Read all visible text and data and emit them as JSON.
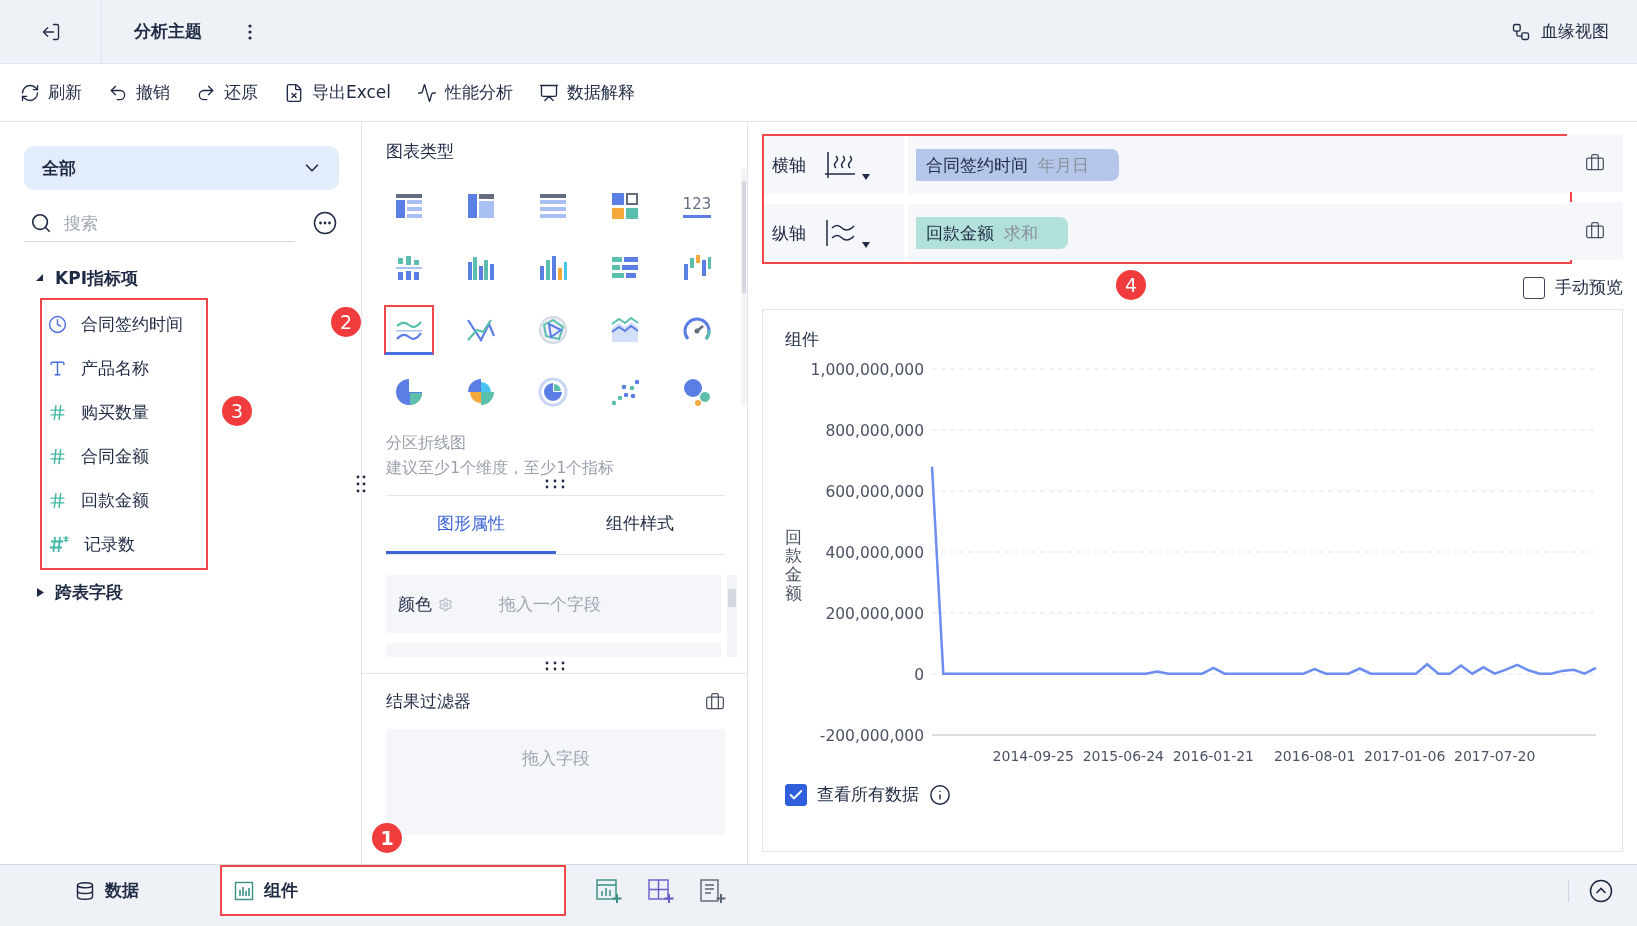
{
  "header": {
    "title": "分析主题",
    "lineage_button": "血缘视图"
  },
  "toolbar": [
    {
      "kind": "refresh",
      "label": "刷新"
    },
    {
      "kind": "undo",
      "label": "撤销"
    },
    {
      "kind": "redo",
      "label": "还原"
    },
    {
      "kind": "export",
      "label": "导出Excel"
    },
    {
      "kind": "performance",
      "label": "性能分析"
    },
    {
      "kind": "explain",
      "label": "数据解释"
    }
  ],
  "data_panel": {
    "scope": "全部",
    "search": {
      "placeholder": "搜索"
    },
    "groups": [
      {
        "label": "KPI指标项",
        "expanded": true,
        "highlighted": true,
        "badge": "3",
        "children": [
          {
            "kind": "date",
            "label": "合同签约时间"
          },
          {
            "kind": "text",
            "label": "产品名称"
          },
          {
            "kind": "number",
            "label": "购买数量"
          },
          {
            "kind": "number",
            "label": "合同金额"
          },
          {
            "kind": "number",
            "label": "回款金额"
          },
          {
            "kind": "count",
            "label": "记录数"
          }
        ]
      },
      {
        "label": "跨表字段",
        "expanded": false
      }
    ]
  },
  "chart_type_panel": {
    "title": "图表类型",
    "badge": "2",
    "types": [
      {
        "kind": "grouped-table",
        "selected": false
      },
      {
        "kind": "cross-table",
        "selected": false
      },
      {
        "kind": "detail-table",
        "selected": false
      },
      {
        "kind": "tile",
        "selected": false
      },
      {
        "kind": "number",
        "glyph": "123",
        "selected": false
      },
      {
        "kind": "stacked-bar",
        "selected": false
      },
      {
        "kind": "grouped-column",
        "selected": false
      },
      {
        "kind": "column",
        "selected": false
      },
      {
        "kind": "bar",
        "selected": false
      },
      {
        "kind": "waterfall",
        "selected": false
      },
      {
        "kind": "partition-line",
        "selected": true
      },
      {
        "kind": "line",
        "selected": false
      },
      {
        "kind": "radar",
        "selected": false
      },
      {
        "kind": "area",
        "selected": false
      },
      {
        "kind": "gauge",
        "selected": false
      },
      {
        "kind": "pie",
        "selected": false
      },
      {
        "kind": "rose",
        "selected": false
      },
      {
        "kind": "ring",
        "selected": false
      },
      {
        "kind": "scatter",
        "selected": false
      },
      {
        "kind": "bubble",
        "selected": false
      }
    ],
    "description": "分区折线图",
    "hint": "建议至少1个维度，至少1个指标",
    "tabs": [
      {
        "label": "图形属性",
        "selected": true
      },
      {
        "label": "组件样式",
        "selected": false
      }
    ],
    "properties": [
      {
        "label": "颜色",
        "drop_hint": "拖入一个字段"
      }
    ],
    "filter": {
      "title": "结果过滤器",
      "drop_hint": "拖入字段"
    }
  },
  "axes": {
    "highlighted": true,
    "badge": "4",
    "rows": [
      {
        "kind": "x",
        "label": "横轴",
        "field": "合同签约时间",
        "aggregation": "年月日",
        "color": "#b4c7ea"
      },
      {
        "kind": "y",
        "label": "纵轴",
        "field": "回款金额",
        "aggregation": "求和",
        "color": "#b2e0da"
      }
    ]
  },
  "manual_preview": {
    "label": "手动预览",
    "checked": false
  },
  "widget": {
    "title": "组件",
    "chart_data": {
      "type": "line",
      "grid": true,
      "ylabel": "回款金额",
      "ylim": [
        -200000000,
        1000000000
      ],
      "yticks": [
        {
          "value": 1000000000,
          "label": "1,000,000,000"
        },
        {
          "value": 800000000,
          "label": "800,000,000"
        },
        {
          "value": 600000000,
          "label": "600,000,000"
        },
        {
          "value": 400000000,
          "label": "400,000,000"
        },
        {
          "value": 200000000,
          "label": "200,000,000"
        },
        {
          "value": 0,
          "label": "0"
        },
        {
          "value": -200000000,
          "label": "-200,000,000"
        }
      ],
      "categories": [
        null,
        null,
        null,
        null,
        null,
        null,
        null,
        null,
        null,
        "2014-09-25",
        null,
        null,
        null,
        null,
        null,
        null,
        null,
        "2015-06-24",
        null,
        null,
        null,
        null,
        null,
        null,
        null,
        "2016-01-21",
        null,
        null,
        null,
        null,
        null,
        null,
        null,
        null,
        "2016-08-01",
        null,
        null,
        null,
        null,
        null,
        null,
        null,
        "2017-01-06",
        null,
        null,
        null,
        null,
        null,
        null,
        null,
        "2017-07-20",
        null,
        null,
        null,
        null,
        null,
        null,
        null,
        null,
        null
      ],
      "series": [
        {
          "color": "#6b8ef0",
          "values": [
            680000000,
            1000000,
            1000000,
            1000000,
            1000000,
            1000000,
            1000000,
            1000000,
            1000000,
            1000000,
            1000000,
            1000000,
            1000000,
            1000000,
            1000000,
            1000000,
            1000000,
            1000000,
            1000000,
            1000000,
            8000000,
            1000000,
            1000000,
            1000000,
            1000000,
            20000000,
            1000000,
            1000000,
            1000000,
            1000000,
            1000000,
            1000000,
            1000000,
            1000000,
            16000000,
            1000000,
            1000000,
            1000000,
            18000000,
            1000000,
            1000000,
            1000000,
            1000000,
            1000000,
            32000000,
            1000000,
            1000000,
            28000000,
            1000000,
            22000000,
            1000000,
            14000000,
            30000000,
            12000000,
            1000000,
            1000000,
            10000000,
            14000000,
            1000000,
            20000000
          ]
        }
      ]
    },
    "show_all": {
      "label": "查看所有数据",
      "checked": true
    }
  },
  "bottom_bar": {
    "tabs": [
      {
        "kind": "data",
        "label": "数据",
        "selected": false,
        "highlighted": false
      },
      {
        "kind": "widget",
        "label": "组件",
        "selected": true,
        "highlighted": true,
        "badge": "1"
      }
    ]
  }
}
